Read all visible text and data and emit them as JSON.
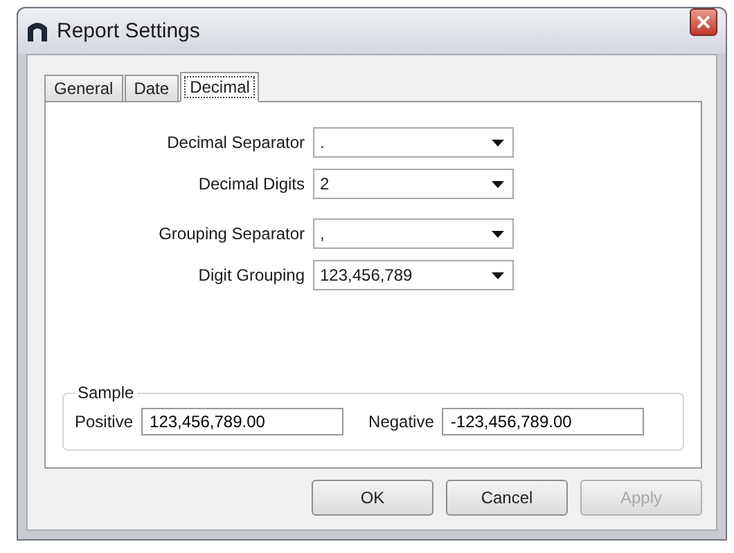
{
  "window": {
    "title": "Report Settings"
  },
  "tabs": [
    {
      "label": "General",
      "selected": false
    },
    {
      "label": "Date",
      "selected": false
    },
    {
      "label": "Decimal",
      "selected": true
    }
  ],
  "fields": [
    {
      "label": "Decimal Separator",
      "value": "."
    },
    {
      "label": "Decimal Digits",
      "value": "2"
    },
    {
      "label": "Grouping Separator",
      "value": ","
    },
    {
      "label": "Digit Grouping",
      "value": "123,456,789"
    }
  ],
  "sample": {
    "title": "Sample",
    "entries": [
      {
        "label": "Positive",
        "value": "123,456,789.00"
      },
      {
        "label": "Negative",
        "value": "-123,456,789.00"
      }
    ]
  },
  "buttons": [
    {
      "label": "OK",
      "disabled": false
    },
    {
      "label": "Cancel",
      "disabled": false
    },
    {
      "label": "Apply",
      "disabled": true
    }
  ]
}
